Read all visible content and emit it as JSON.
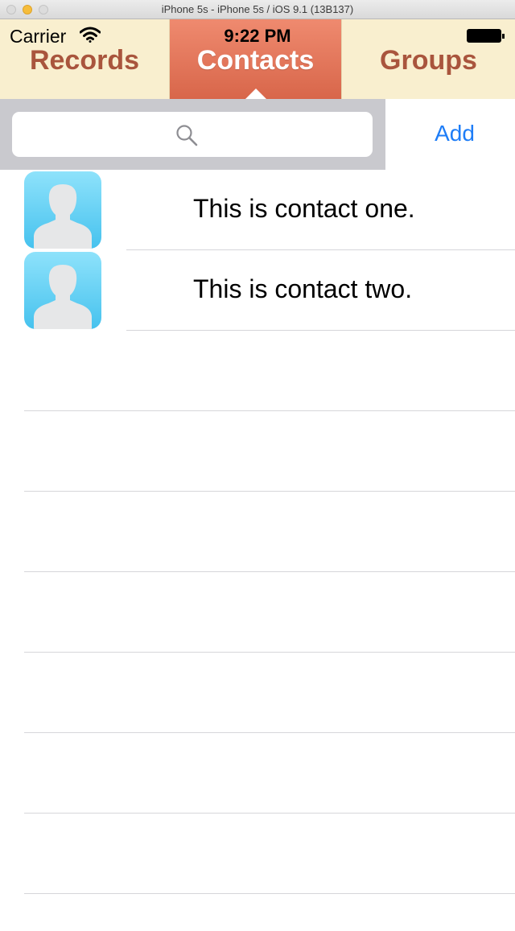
{
  "window": {
    "title": "iPhone 5s - iPhone 5s / iOS 9.1 (13B137)"
  },
  "status_bar": {
    "carrier": "Carrier",
    "time": "9:22 PM"
  },
  "tabs": [
    {
      "label": "Records",
      "selected": false
    },
    {
      "label": "Contacts",
      "selected": true
    },
    {
      "label": "Groups",
      "selected": false
    }
  ],
  "search": {
    "placeholder": "",
    "add_label": "Add"
  },
  "contacts": [
    {
      "name": "This is contact one.",
      "icon": "avatar-icon"
    },
    {
      "name": "This is contact two.",
      "icon": "avatar-icon"
    }
  ],
  "colors": {
    "tab_background": "#f9efcf",
    "tab_selected": "#e0725a",
    "tab_text": "#a9553d",
    "link": "#1e7df7",
    "search_background": "#c9c9ce",
    "avatar": "#5acdf3"
  }
}
